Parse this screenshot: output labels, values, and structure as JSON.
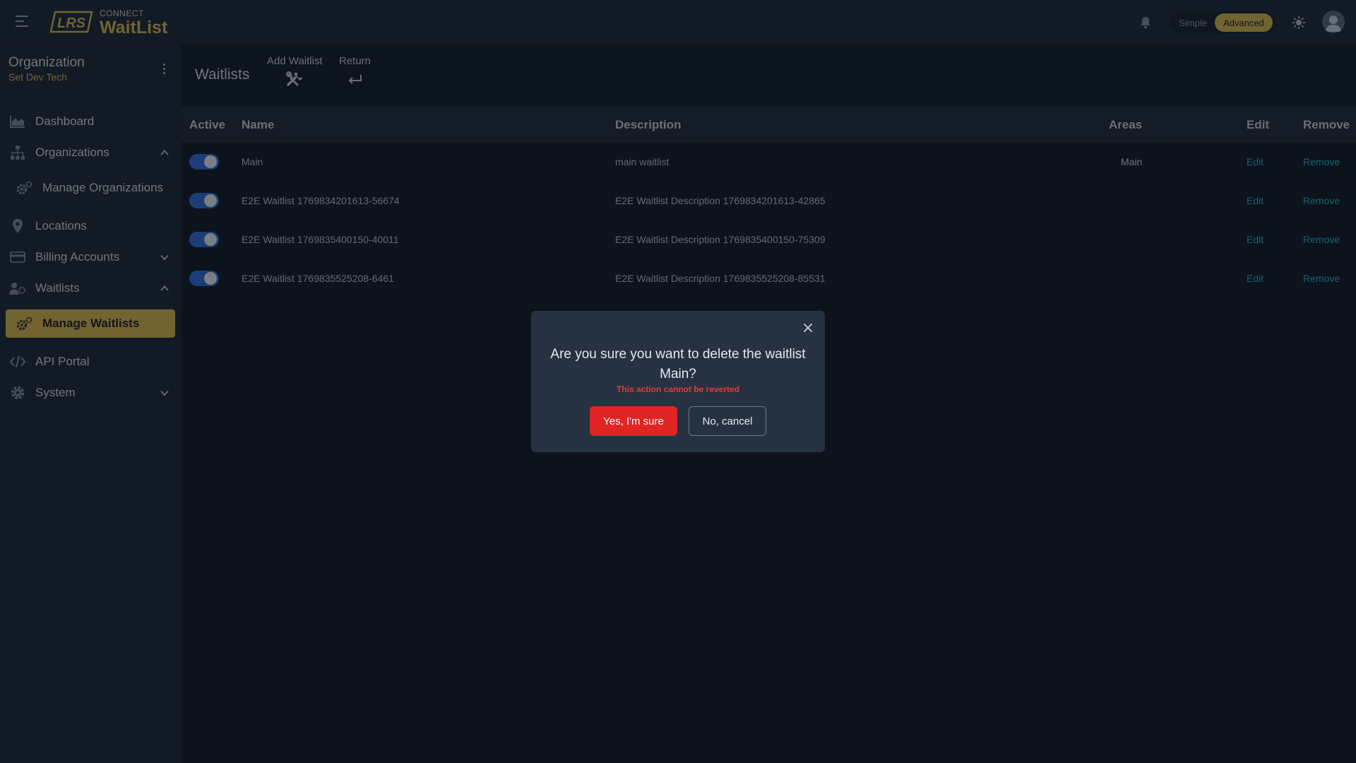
{
  "brand": {
    "small": "CONNECT",
    "name": "WaitList",
    "logo_text": "LRS",
    "accent": "#d8b94a"
  },
  "header": {
    "modes": [
      "Simple",
      "Advanced"
    ],
    "selected_mode": "Advanced"
  },
  "sidebar": {
    "org_title": "Organization",
    "org_subtitle": "Set Dev Tech",
    "items": [
      {
        "label": "Dashboard",
        "icon": "chart-area-icon"
      },
      {
        "label": "Organizations",
        "icon": "sitemap-icon",
        "expanded": true
      },
      {
        "label": "Manage Organizations",
        "icon": "gears-icon",
        "sub": true
      },
      {
        "label": "Locations",
        "icon": "location-pin-icon"
      },
      {
        "label": "Billing Accounts",
        "icon": "credit-card-icon",
        "expanded": false
      },
      {
        "label": "Waitlists",
        "icon": "users-gear-icon",
        "expanded": true
      },
      {
        "label": "Manage Waitlists",
        "icon": "gears-icon",
        "sub": true,
        "active": true
      },
      {
        "label": "API Portal",
        "icon": "code-icon"
      },
      {
        "label": "System",
        "icon": "gear-icon",
        "expanded": false
      }
    ]
  },
  "main": {
    "title": "Waitlists",
    "actions": {
      "add_label": "Add Waitlist",
      "return_label": "Return"
    },
    "table": {
      "headers": {
        "active": "Active",
        "name": "Name",
        "description": "Description",
        "areas": "Areas",
        "edit": "Edit",
        "remove": "Remove"
      },
      "rows": [
        {
          "active": true,
          "name": "Main",
          "description": "main waitlist",
          "areas": "Main",
          "edit": "Edit",
          "remove": "Remove"
        },
        {
          "active": true,
          "name": "E2E Waitlist 1769834201613-56674",
          "description": "E2E Waitlist Description 1769834201613-42865",
          "areas": "",
          "edit": "Edit",
          "remove": "Remove"
        },
        {
          "active": true,
          "name": "E2E Waitlist 1769835400150-40011",
          "description": "E2E Waitlist Description 1769835400150-75309",
          "areas": "",
          "edit": "Edit",
          "remove": "Remove"
        },
        {
          "active": true,
          "name": "E2E Waitlist 1769835525208-6461",
          "description": "E2E Waitlist Description 1769835525208-85531",
          "areas": "",
          "edit": "Edit",
          "remove": "Remove"
        }
      ]
    }
  },
  "modal": {
    "message": "Are you sure you want to delete the waitlist Main?",
    "warning": "This action cannot be reverted",
    "confirm_label": "Yes, I'm sure",
    "cancel_label": "No, cancel",
    "danger_color": "#e02424"
  }
}
